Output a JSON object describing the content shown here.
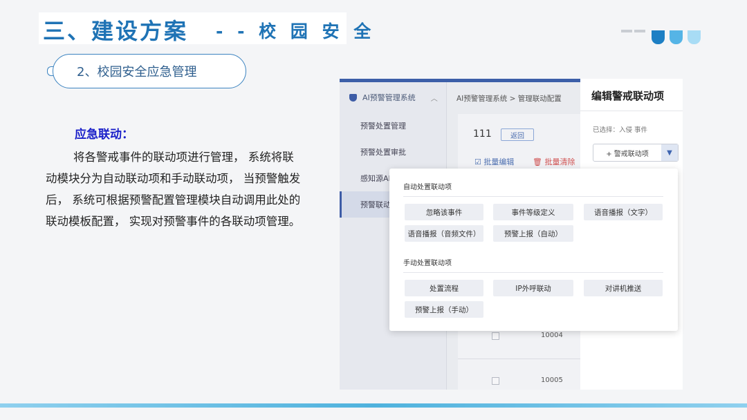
{
  "header": {
    "title": "三、建设方案",
    "subtitle": "- - 校 园 安 全"
  },
  "section_pill": "2、校园安全应急管理",
  "content": {
    "heading": "应急联动：",
    "body": "将各警戒事件的联动项进行管理， 系统将联动模块分为自动联动项和手动联动项， 当预警触发后， 系统可根据预警配置管理模块自动调用此处的联动模板配置， 实现对预警事件的各联动项管理。"
  },
  "colors": {
    "title": "#1f73b5",
    "heading": "#1a1fc9",
    "shield_1": "#1d7fc4",
    "shield_2": "#55b4e6",
    "shield_3": "#a8dcf5"
  },
  "screenshot": {
    "sidebar": {
      "system_name": "AI预警管理系统",
      "items": [
        "预警处置管理",
        "预警处置审批",
        "感知源AI",
        "预警联动"
      ]
    },
    "breadcrumb": "AI预警管理系统  >  管理联动配置",
    "record_label": "111",
    "back_button": "返回",
    "batch_edit": "批量编辑",
    "batch_clear": "批量清除",
    "rows": [
      "10004",
      "10005"
    ],
    "edit_panel": {
      "title": "编辑警戒联动项",
      "selected": "已选择：入侵 事件",
      "dropdown_label": "+ 警戒联动项"
    },
    "popup": {
      "auto_title": "自动处置联动项",
      "auto_items": [
        "忽略该事件",
        "事件等级定义",
        "语音播报（文字）",
        "语音播报（音频文件）",
        "预警上报（自动）"
      ],
      "manual_title": "手动处置联动项",
      "manual_items": [
        "处置流程",
        "IP外呼联动",
        "对讲机推送",
        "预警上报（手动）"
      ]
    }
  }
}
